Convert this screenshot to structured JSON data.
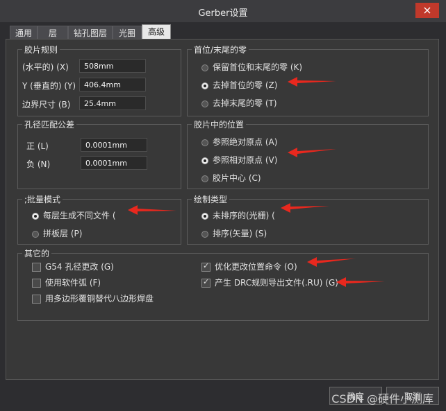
{
  "window": {
    "title": "Gerber设置",
    "close_label": "×"
  },
  "tabs": [
    "通用",
    "层",
    "钻孔图层",
    "光圈",
    "高级"
  ],
  "film_rules": {
    "title": "胶片规则",
    "fields": [
      {
        "label": "(水平的) (X)",
        "value": "508mm"
      },
      {
        "label": "Y (垂直的) (Y)",
        "value": "406.4mm"
      },
      {
        "label": "边界尺寸 (B)",
        "value": "25.4mm"
      }
    ]
  },
  "leading_zeros": {
    "title": "首位/末尾的零",
    "options": [
      "保留首位和末尾的零 (K)",
      "去掉首位的零 (Z)",
      "去掉末尾的零 (T)"
    ]
  },
  "hole_tolerance": {
    "title": "孔径匹配公差",
    "fields": [
      {
        "label": "正 (L)",
        "value": "0.0001mm"
      },
      {
        "label": "负 (N)",
        "value": "0.0001mm"
      }
    ]
  },
  "film_position": {
    "title": "胶片中的位置",
    "options": [
      "参照绝对原点 (A)",
      "参照相对原点 (V)",
      "胶片中心 (C)"
    ]
  },
  "batch_mode": {
    "title": ";批量模式",
    "options": [
      "每层生成不同文件 (",
      "拼板层 (P)"
    ]
  },
  "plot_type": {
    "title": "绘制类型",
    "options": [
      "未排序的(光栅) (",
      "排序(矢量) (S)"
    ]
  },
  "other": {
    "title": "其它的",
    "checks": [
      "G54 孔径更改 (G)",
      "使用软件弧 (F)",
      "用多边形覆铜替代八边形焊盘",
      "优化更改位置命令 (O)",
      "产生 DRC规则导出文件(.RU) (G)"
    ]
  },
  "buttons": {
    "ok": "确定",
    "cancel": "取消"
  },
  "watermark": "CSDN @硬件小测库",
  "colors": {
    "arrow": "#e8281e",
    "close": "#c0392b"
  }
}
